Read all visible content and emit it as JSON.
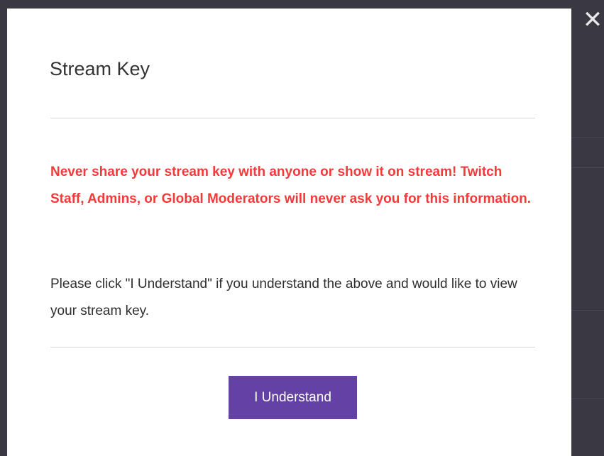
{
  "modal": {
    "title": "Stream Key",
    "warning": "Never share your stream key with anyone or show it on stream! Twitch Staff, Admins, or Global Moderators will never ask you for this information.",
    "instructions": "Please click \"I Understand\" if you understand the above and would like to view your stream key.",
    "confirm_label": "I Understand",
    "close_icon": "close-icon"
  },
  "colors": {
    "accent": "#6441a5",
    "warning": "#f33a3a",
    "backdrop": "#3a3842"
  }
}
